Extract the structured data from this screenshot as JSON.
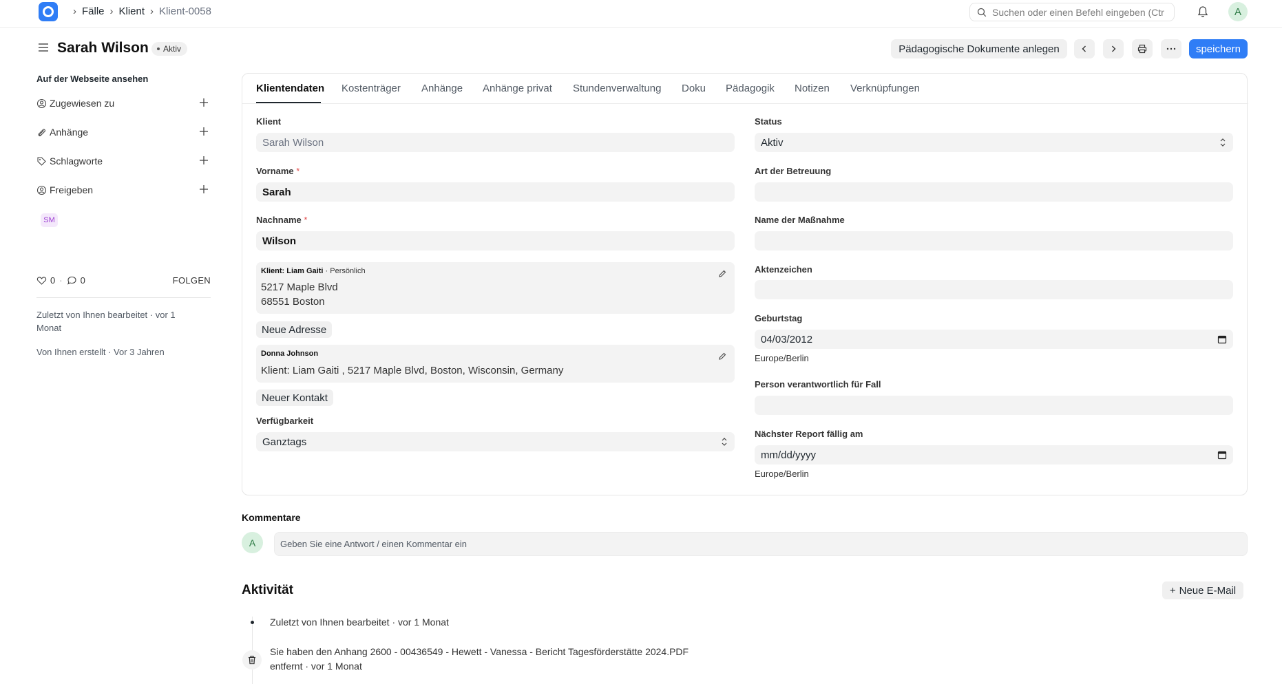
{
  "nav": {
    "breadcrumbs": [
      "Fälle",
      "Klient",
      "Klient-0058"
    ],
    "search_placeholder": "Suchen oder einen Befehl eingeben (Ctrl+G)",
    "avatar_letter": "A"
  },
  "header": {
    "title": "Sarah Wilson",
    "status": "Aktiv",
    "doc_button": "Pädagogische Dokumente anlegen",
    "save_button": "speichern"
  },
  "sidebar": {
    "heading": "Auf der Webseite ansehen",
    "items": [
      "Zugewiesen zu",
      "Anhänge",
      "Schlagworte",
      "Freigeben"
    ],
    "shared_badge": "SM",
    "likes": "0",
    "comments": "0",
    "follow": "FOLGEN",
    "edited": "Zuletzt von Ihnen bearbeitet · vor 1 Monat",
    "created": "Von Ihnen erstellt · Vor 3 Jahren"
  },
  "tabs": [
    "Klientendaten",
    "Kostenträger",
    "Anhänge",
    "Anhänge privat",
    "Stundenverwaltung",
    "Doku",
    "Pädagogik",
    "Notizen",
    "Verknüpfungen"
  ],
  "form": {
    "klient_label": "Klient",
    "klient_value": "Sarah Wilson",
    "vorname_label": "Vorname",
    "vorname_value": "Sarah",
    "nachname_label": "Nachname",
    "nachname_value": "Wilson",
    "required_mark": "*",
    "address": {
      "head_bold": "Klient: Liam Gaiti",
      "head_rest": " · Persönlich",
      "line1": "5217 Maple Blvd",
      "line2": "68551 Boston"
    },
    "new_address_button": "Neue Adresse",
    "contact": {
      "head_bold": "Donna Johnson",
      "line1": "Klient: Liam Gaiti , 5217 Maple Blvd, Boston, Wisconsin, Germany"
    },
    "new_contact_button": "Neuer Kontakt",
    "verfuegbarkeit_label": "Verfügbarkeit",
    "verfuegbarkeit_value": "Ganztags",
    "status_label": "Status",
    "status_value": "Aktiv",
    "art_label": "Art der Betreuung",
    "art_value": "",
    "massnahme_label": "Name der Maßnahme",
    "massnahme_value": "",
    "aktenzeichen_label": "Aktenzeichen",
    "aktenzeichen_value": "",
    "geburtstag_label": "Geburtstag",
    "geburtstag_value": "04/03/2012",
    "timezone": "Europe/Berlin",
    "person_label": "Person verantwortlich für Fall",
    "person_value": "",
    "report_label": "Nächster Report fällig am",
    "report_value": "mm/dd/yyyy"
  },
  "comments": {
    "label": "Kommentare",
    "avatar_letter": "A",
    "placeholder": "Geben Sie eine Antwort / einen Kommentar ein"
  },
  "activity": {
    "title": "Aktivität",
    "new_mail_button": "Neue E-Mail",
    "entries": [
      "Zuletzt von Ihnen bearbeitet · vor 1 Monat",
      "Sie haben den Anhang 2600 - 00436549 - Hewett - Vanessa - Bericht Tagesförderstätte 2024.PDF",
      "entfernt · vor 1 Monat"
    ]
  }
}
